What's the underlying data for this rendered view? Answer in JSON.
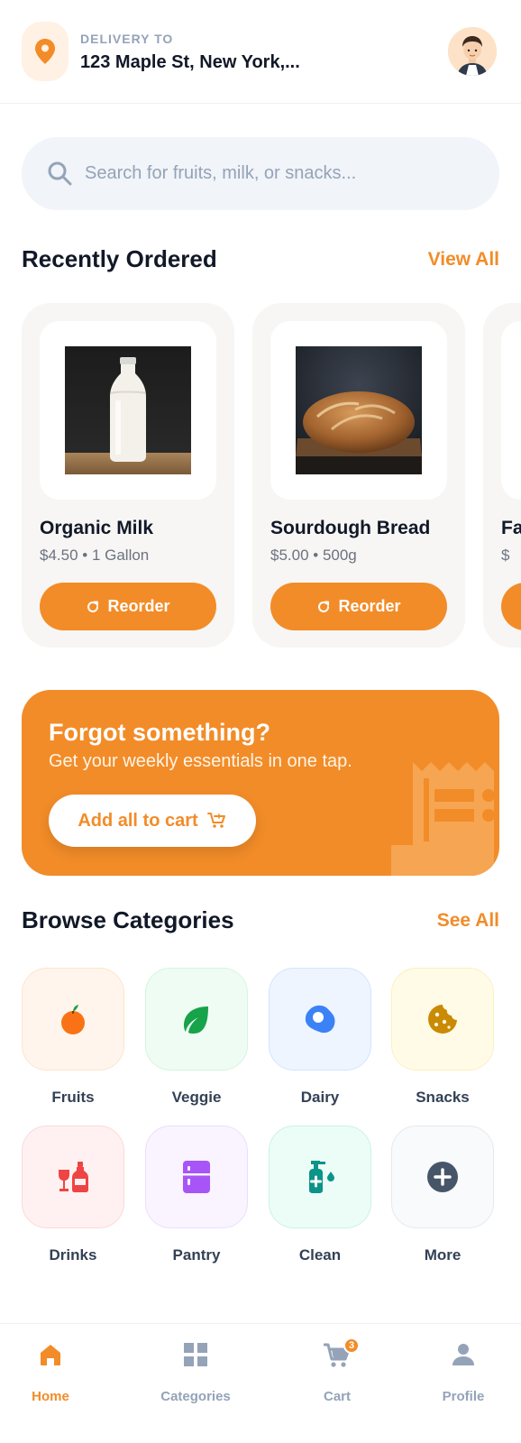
{
  "header": {
    "delivery_label": "DELIVERY TO",
    "address": "123 Maple St, New York,...",
    "avatar_icon": "user-avatar",
    "pin_icon": "map-pin-icon"
  },
  "search": {
    "placeholder": "Search for fruits, milk, or snacks...",
    "value": ""
  },
  "recent": {
    "title": "Recently Ordered",
    "link": "View All",
    "items": [
      {
        "name": "Organic Milk",
        "meta": "$4.50 • 1 Gallon",
        "button": "Reorder"
      },
      {
        "name": "Sourdough Bread",
        "meta": "$5.00 • 500g",
        "button": "Reorder"
      },
      {
        "name": "Fa",
        "meta": "$",
        "button": ""
      }
    ]
  },
  "promo": {
    "title": "Forgot something?",
    "subtitle": "Get your weekly essentials in one tap.",
    "button": "Add all to cart"
  },
  "categories": {
    "title": "Browse Categories",
    "link": "See All",
    "items": [
      {
        "label": "Fruits",
        "icon": "fruit-icon"
      },
      {
        "label": "Veggie",
        "icon": "leaf-icon"
      },
      {
        "label": "Dairy",
        "icon": "egg-icon"
      },
      {
        "label": "Snacks",
        "icon": "cookie-icon"
      },
      {
        "label": "Drinks",
        "icon": "drinks-icon"
      },
      {
        "label": "Pantry",
        "icon": "pantry-icon"
      },
      {
        "label": "Clean",
        "icon": "soap-icon"
      },
      {
        "label": "More",
        "icon": "plus-circle-icon"
      }
    ]
  },
  "nav": {
    "items": [
      {
        "label": "Home",
        "icon": "home-icon",
        "active": true
      },
      {
        "label": "Categories",
        "icon": "grid-icon",
        "active": false
      },
      {
        "label": "Cart",
        "icon": "cart-icon",
        "active": false,
        "badge": "3"
      },
      {
        "label": "Profile",
        "icon": "user-icon",
        "active": false
      }
    ]
  },
  "colors": {
    "accent": "#f28c28",
    "text": "#111827",
    "muted": "#94a3b8"
  }
}
